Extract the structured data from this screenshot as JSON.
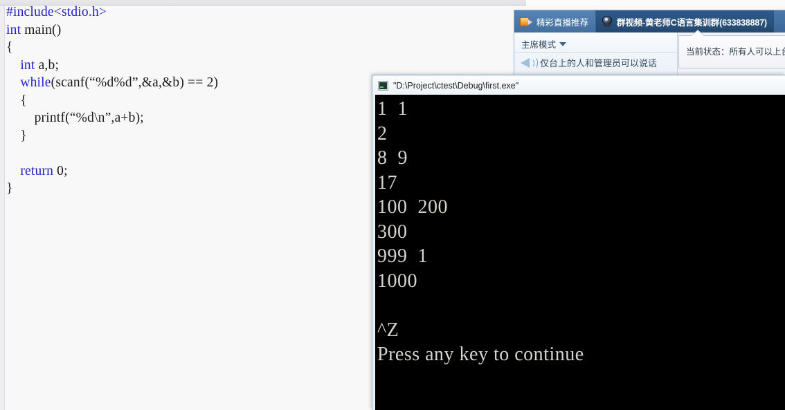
{
  "editor": {
    "name": "c-source-editor",
    "language": "c",
    "code_lines": [
      {
        "tokens": [
          {
            "t": "#include<stdio.h>",
            "k": "kw"
          }
        ]
      },
      {
        "tokens": [
          {
            "t": "int",
            "k": "kw"
          },
          {
            "t": " main()",
            "k": "pl"
          }
        ]
      },
      {
        "tokens": [
          {
            "t": "{",
            "k": "pl"
          }
        ]
      },
      {
        "tokens": [
          {
            "t": "    ",
            "k": "pl"
          },
          {
            "t": "int",
            "k": "kw"
          },
          {
            "t": " a,b;",
            "k": "pl"
          }
        ]
      },
      {
        "tokens": [
          {
            "t": "    ",
            "k": "pl"
          },
          {
            "t": "while",
            "k": "kw"
          },
          {
            "t": "(scanf(“%d%d”,&a,&b) == 2)",
            "k": "pl"
          }
        ]
      },
      {
        "tokens": [
          {
            "t": "    {",
            "k": "pl"
          }
        ]
      },
      {
        "tokens": [
          {
            "t": "        printf(“%d\\n”,a+b);",
            "k": "pl"
          }
        ]
      },
      {
        "tokens": [
          {
            "t": "    }",
            "k": "pl"
          }
        ]
      },
      {
        "tokens": [
          {
            "t": "",
            "k": "pl"
          }
        ]
      },
      {
        "tokens": [
          {
            "t": "    ",
            "k": "pl"
          },
          {
            "t": "return",
            "k": "kw"
          },
          {
            "t": " 0;",
            "k": "pl"
          }
        ]
      },
      {
        "tokens": [
          {
            "t": "}",
            "k": "pl"
          }
        ]
      }
    ]
  },
  "qq_window": {
    "tabs": [
      {
        "label": "精彩直播推荐",
        "icon": "video-camera-icon",
        "active": false
      },
      {
        "label": "群视频-黄老师C语言集训群(633838887)",
        "icon": "webcam-icon",
        "active": true
      }
    ],
    "mode_selector": {
      "label": "主席模式",
      "icon": "chevron-down-icon"
    },
    "notice": {
      "label": "仅台上的人和管理员可以说话",
      "icon": "speaker-icon"
    },
    "tooltip": {
      "text": "当前状态：所有人可以上台"
    },
    "colors": {
      "tabbar_active": "#2f5a8a",
      "tabbar_inactive": "#5583b5",
      "panel_bg": "#f4f7fb"
    }
  },
  "console_window": {
    "title": "\"D:\\Project\\ctest\\Debug\\first.exe\"",
    "icon": "console-app-icon",
    "output_lines": [
      "1  1",
      "2",
      "8  9",
      "17",
      "100  200",
      "300",
      "999  1",
      "1000",
      "",
      "^Z",
      "Press any key to continue"
    ],
    "colors": {
      "background": "#000000",
      "text": "#d7d4cd"
    }
  }
}
